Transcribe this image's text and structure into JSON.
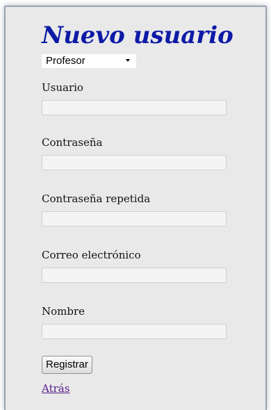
{
  "form": {
    "title": "Nuevo usuario",
    "role_select": {
      "selected": "Profesor"
    },
    "fields": [
      {
        "label": "Usuario",
        "value": ""
      },
      {
        "label": "Contraseña",
        "value": ""
      },
      {
        "label": "Contraseña repetida",
        "value": ""
      },
      {
        "label": "Correo electrónico",
        "value": ""
      },
      {
        "label": "Nombre",
        "value": ""
      }
    ],
    "submit_label": "Registrar",
    "back_link": "Atrás"
  },
  "colors": {
    "title": "#0d1aa6",
    "link_visited": "#551a8b",
    "panel_bg": "#e9e9e9"
  }
}
